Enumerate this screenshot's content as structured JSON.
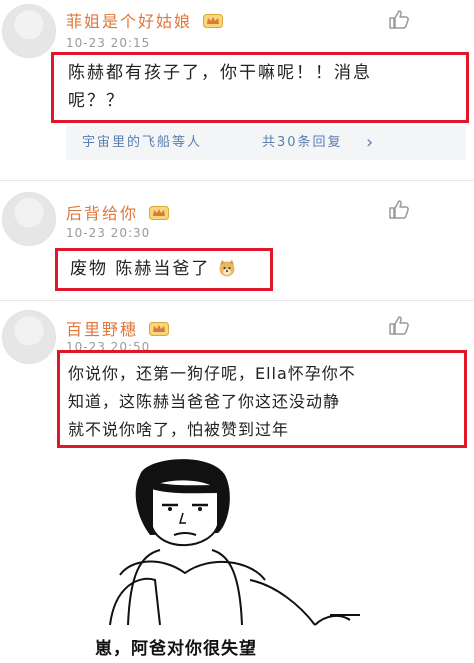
{
  "comments": [
    {
      "username": "菲姐是个好姑娘",
      "time": "10-23 20:15",
      "text_line1": "陈赫都有孩子了，你干嘛呢！！消息",
      "text_line2": "呢？？",
      "reply_author": "宇宙里的飞船等人",
      "reply_count": "共30条回复",
      "reply_arrow": "›"
    },
    {
      "username": "后背给你",
      "time": "10-23 20:30",
      "text": "废物  陈赫当爸了",
      "emoji": "doge"
    },
    {
      "username": "百里野穗",
      "time": "10-23 20:50",
      "text_line1": "你说你，还第一狗仔呢，Ella怀孕你不",
      "text_line2": "知道，这陈赫当爸爸了你这还没动静",
      "text_line3": "就不说你啥了，怕被赞到过年"
    }
  ],
  "meme": {
    "caption": "崽，阿爸对你很失望"
  },
  "icons": {
    "avatar": "default-avatar-icon",
    "like": "thumbs-up-icon",
    "badge": "crown-badge-icon"
  },
  "colors": {
    "username": "#e0773a",
    "highlight_border": "#e0162b",
    "reply_link": "#5b7fb0"
  }
}
